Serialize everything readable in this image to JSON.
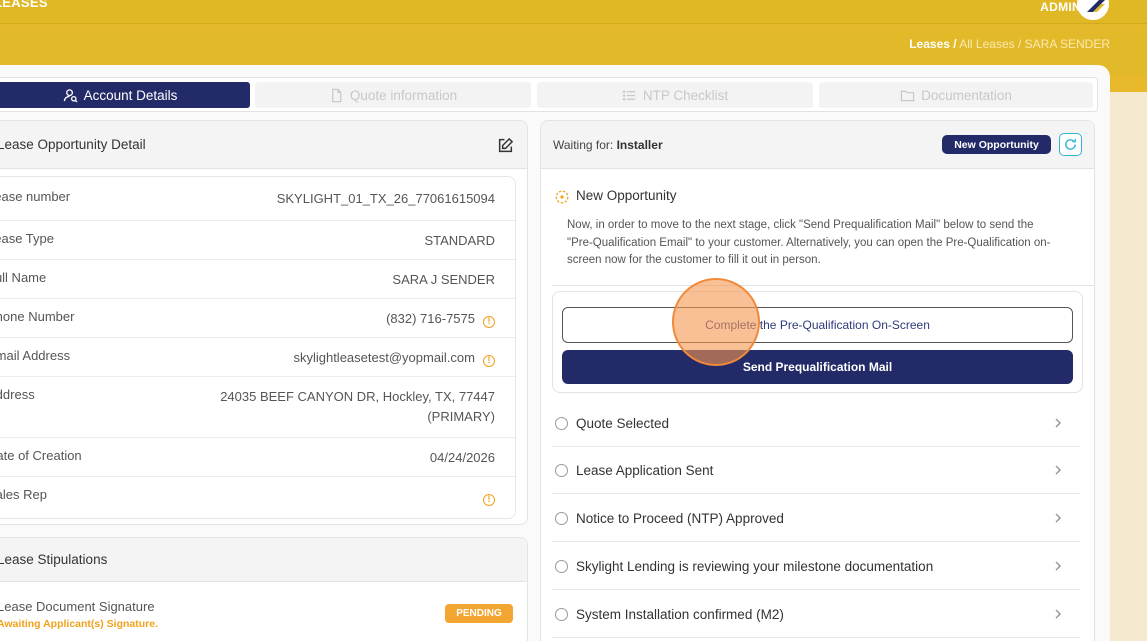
{
  "header": {
    "title": "LEASES",
    "user_role": "ADMIN",
    "breadcrumb": {
      "root": "Leases /",
      "mid": " All Leases / ",
      "current": "SARA SENDER"
    }
  },
  "tabs": [
    {
      "label": "Account Details",
      "icon": "user-search-icon",
      "active": true
    },
    {
      "label": "Quote information",
      "icon": "document-icon",
      "active": false
    },
    {
      "label": "NTP Checklist",
      "icon": "list-icon",
      "active": false
    },
    {
      "label": "Documentation",
      "icon": "folder-icon",
      "active": false
    }
  ],
  "lease_detail": {
    "title": "Lease Opportunity Detail",
    "rows": [
      {
        "label": "Lease number",
        "value": "SKYLIGHT_01_TX_26_77061615094"
      },
      {
        "label": "Lease Type",
        "value": "STANDARD"
      },
      {
        "label": "Full Name",
        "value": "SARA J SENDER"
      },
      {
        "label": "Phone Number",
        "value": "(832) 716-7575"
      },
      {
        "label": "Email Address",
        "value": "skylightleasetest@yopmail.com"
      },
      {
        "label": "Address",
        "value_line1": "24035 BEEF CANYON DR, Hockley, TX, 77447",
        "value_line2": "(PRIMARY)"
      },
      {
        "label": "Date of Creation",
        "value": "04/24/2026"
      },
      {
        "label": "Sales Rep",
        "value": ""
      }
    ]
  },
  "stipulations": {
    "title": "Lease Stipulations",
    "items": [
      {
        "label": "Lease Document Signature",
        "sub": "Awaiting Applicant(s) Signature.",
        "status": "PENDING"
      }
    ]
  },
  "workflow": {
    "waiting_label": "Waiting for:",
    "waiting_value": "Installer",
    "badge": "New Opportunity",
    "current_stage": "New Opportunity",
    "description": "Now, in order to move to the next stage, click \"Send Prequalification Mail\" below to send the \"Pre-Qualification Email\" to your customer. Alternatively, you can open the Pre-Qualification on-screen now for the customer to fill it out in person.",
    "btn_onscreen": "Complete the Pre-Qualification On-Screen",
    "btn_send": "Send Prequalification Mail",
    "stages": [
      "Quote Selected",
      "Lease Application Sent",
      "Notice to Proceed (NTP) Approved",
      "Skylight Lending is reviewing your milestone documentation",
      "System Installation confirmed (M2)"
    ]
  },
  "colors": {
    "brand_yellow": "#e2b929",
    "navy": "#232a68",
    "warning": "#f0a21c",
    "pending": "#f3a531"
  }
}
